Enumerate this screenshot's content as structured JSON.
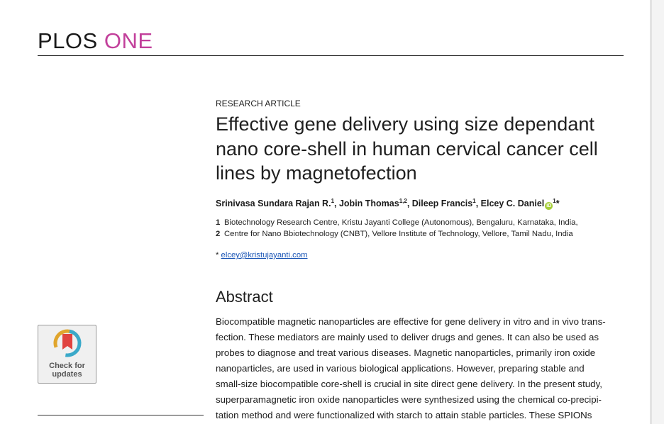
{
  "journal": {
    "name_part1": "PLOS",
    "name_part2": " ONE",
    "accent_color": "#c2409b"
  },
  "article": {
    "type_label": "RESEARCH ARTICLE",
    "title": "Effective gene delivery using size dependant nano core-shell in human cervical cancer cell lines by magnetofection",
    "authors": [
      {
        "name": "Srinivasa Sundara Rajan R.",
        "sup": "1"
      },
      {
        "name": "Jobin Thomas",
        "sup": "1,2"
      },
      {
        "name": "Dileep Francis",
        "sup": "1"
      },
      {
        "name": "Elcey C. Daniel",
        "sup": "1",
        "corresponding": "*"
      }
    ],
    "affiliations": [
      {
        "num": "1",
        "text": "Biotechnology Research Centre, Kristu Jayanti College (Autonomous), Bengaluru, Karnataka, India,"
      },
      {
        "num": "2",
        "text": "Centre for Nano Bbiotechnology (CNBT), Vellore Institute of Technology, Vellore, Tamil Nadu, India"
      }
    ],
    "corresponding": {
      "marker": "*",
      "email": "elcey@kristujayanti.com"
    },
    "abstract_heading": "Abstract",
    "abstract_lines": [
      "Biocompatible magnetic nanoparticles are effective for gene delivery in vitro and in vivo trans-",
      "fection. These mediators are mainly used to deliver drugs and genes. It can also be used as",
      "probes to diagnose and treat various diseases. Magnetic nanoparticles, primarily iron oxide",
      "nanoparticles, are used in various biological applications. However, preparing stable and",
      "small-size biocompatible core-shell is crucial in site direct gene delivery.  In the present study,",
      "superparamagnetic iron oxide nanoparticles were synthesized using the chemical co-precipi-",
      "tation method and were functionalized with starch to attain stable particles. These SPIONs"
    ]
  },
  "badge": {
    "line1": "Check for",
    "line2": "updates",
    "icon": "check-for-updates-icon"
  },
  "orcid_icon": {
    "glyph": "iD",
    "color": "#a6ce39"
  }
}
